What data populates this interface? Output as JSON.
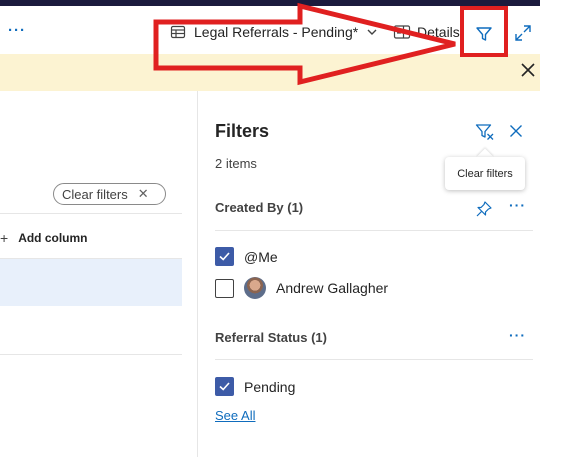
{
  "toolbar": {
    "more_label": "···",
    "view_label": "Legal Referrals - Pending*",
    "details_label": "Details"
  },
  "list": {
    "clear_filters_chip": "Clear filters",
    "clear_chip_x": "✕",
    "add_column_label": "Add column",
    "add_plus": "+"
  },
  "filters_panel": {
    "title": "Filters",
    "count": "2 items",
    "tooltip": "Clear filters",
    "sections": [
      {
        "title": "Created By (1)",
        "options": [
          {
            "label": "@Me",
            "checked": true
          },
          {
            "label": "Andrew Gallagher",
            "checked": false
          }
        ]
      },
      {
        "title": "Referral Status (1)",
        "options": [
          {
            "label": "Pending",
            "checked": true
          }
        ]
      }
    ],
    "see_all": "See All",
    "more_label": "···"
  },
  "colors": {
    "accent": "#0f6cbd",
    "checkbox": "#3d5ba7",
    "banner": "#fcf3d2",
    "annotation": "#e02020",
    "top_strip": "#1b1a3d"
  },
  "icons": [
    "table-view-icon",
    "chevron-down-icon",
    "details-pane-icon",
    "filter-icon",
    "expand-icon",
    "close-icon",
    "clear-filter-icon",
    "pin-icon",
    "check-icon"
  ]
}
